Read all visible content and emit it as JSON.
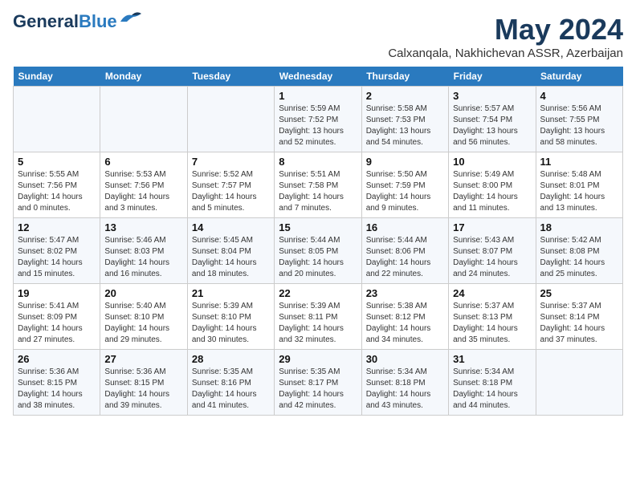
{
  "header": {
    "logo_line1": "General",
    "logo_line2": "Blue",
    "month": "May 2024",
    "location": "Calxanqala, Nakhichevan ASSR, Azerbaijan"
  },
  "days_of_week": [
    "Sunday",
    "Monday",
    "Tuesday",
    "Wednesday",
    "Thursday",
    "Friday",
    "Saturday"
  ],
  "weeks": [
    [
      {
        "day": "",
        "info": ""
      },
      {
        "day": "",
        "info": ""
      },
      {
        "day": "",
        "info": ""
      },
      {
        "day": "1",
        "info": "Sunrise: 5:59 AM\nSunset: 7:52 PM\nDaylight: 13 hours\nand 52 minutes."
      },
      {
        "day": "2",
        "info": "Sunrise: 5:58 AM\nSunset: 7:53 PM\nDaylight: 13 hours\nand 54 minutes."
      },
      {
        "day": "3",
        "info": "Sunrise: 5:57 AM\nSunset: 7:54 PM\nDaylight: 13 hours\nand 56 minutes."
      },
      {
        "day": "4",
        "info": "Sunrise: 5:56 AM\nSunset: 7:55 PM\nDaylight: 13 hours\nand 58 minutes."
      }
    ],
    [
      {
        "day": "5",
        "info": "Sunrise: 5:55 AM\nSunset: 7:56 PM\nDaylight: 14 hours\nand 0 minutes."
      },
      {
        "day": "6",
        "info": "Sunrise: 5:53 AM\nSunset: 7:56 PM\nDaylight: 14 hours\nand 3 minutes."
      },
      {
        "day": "7",
        "info": "Sunrise: 5:52 AM\nSunset: 7:57 PM\nDaylight: 14 hours\nand 5 minutes."
      },
      {
        "day": "8",
        "info": "Sunrise: 5:51 AM\nSunset: 7:58 PM\nDaylight: 14 hours\nand 7 minutes."
      },
      {
        "day": "9",
        "info": "Sunrise: 5:50 AM\nSunset: 7:59 PM\nDaylight: 14 hours\nand 9 minutes."
      },
      {
        "day": "10",
        "info": "Sunrise: 5:49 AM\nSunset: 8:00 PM\nDaylight: 14 hours\nand 11 minutes."
      },
      {
        "day": "11",
        "info": "Sunrise: 5:48 AM\nSunset: 8:01 PM\nDaylight: 14 hours\nand 13 minutes."
      }
    ],
    [
      {
        "day": "12",
        "info": "Sunrise: 5:47 AM\nSunset: 8:02 PM\nDaylight: 14 hours\nand 15 minutes."
      },
      {
        "day": "13",
        "info": "Sunrise: 5:46 AM\nSunset: 8:03 PM\nDaylight: 14 hours\nand 16 minutes."
      },
      {
        "day": "14",
        "info": "Sunrise: 5:45 AM\nSunset: 8:04 PM\nDaylight: 14 hours\nand 18 minutes."
      },
      {
        "day": "15",
        "info": "Sunrise: 5:44 AM\nSunset: 8:05 PM\nDaylight: 14 hours\nand 20 minutes."
      },
      {
        "day": "16",
        "info": "Sunrise: 5:44 AM\nSunset: 8:06 PM\nDaylight: 14 hours\nand 22 minutes."
      },
      {
        "day": "17",
        "info": "Sunrise: 5:43 AM\nSunset: 8:07 PM\nDaylight: 14 hours\nand 24 minutes."
      },
      {
        "day": "18",
        "info": "Sunrise: 5:42 AM\nSunset: 8:08 PM\nDaylight: 14 hours\nand 25 minutes."
      }
    ],
    [
      {
        "day": "19",
        "info": "Sunrise: 5:41 AM\nSunset: 8:09 PM\nDaylight: 14 hours\nand 27 minutes."
      },
      {
        "day": "20",
        "info": "Sunrise: 5:40 AM\nSunset: 8:10 PM\nDaylight: 14 hours\nand 29 minutes."
      },
      {
        "day": "21",
        "info": "Sunrise: 5:39 AM\nSunset: 8:10 PM\nDaylight: 14 hours\nand 30 minutes."
      },
      {
        "day": "22",
        "info": "Sunrise: 5:39 AM\nSunset: 8:11 PM\nDaylight: 14 hours\nand 32 minutes."
      },
      {
        "day": "23",
        "info": "Sunrise: 5:38 AM\nSunset: 8:12 PM\nDaylight: 14 hours\nand 34 minutes."
      },
      {
        "day": "24",
        "info": "Sunrise: 5:37 AM\nSunset: 8:13 PM\nDaylight: 14 hours\nand 35 minutes."
      },
      {
        "day": "25",
        "info": "Sunrise: 5:37 AM\nSunset: 8:14 PM\nDaylight: 14 hours\nand 37 minutes."
      }
    ],
    [
      {
        "day": "26",
        "info": "Sunrise: 5:36 AM\nSunset: 8:15 PM\nDaylight: 14 hours\nand 38 minutes."
      },
      {
        "day": "27",
        "info": "Sunrise: 5:36 AM\nSunset: 8:15 PM\nDaylight: 14 hours\nand 39 minutes."
      },
      {
        "day": "28",
        "info": "Sunrise: 5:35 AM\nSunset: 8:16 PM\nDaylight: 14 hours\nand 41 minutes."
      },
      {
        "day": "29",
        "info": "Sunrise: 5:35 AM\nSunset: 8:17 PM\nDaylight: 14 hours\nand 42 minutes."
      },
      {
        "day": "30",
        "info": "Sunrise: 5:34 AM\nSunset: 8:18 PM\nDaylight: 14 hours\nand 43 minutes."
      },
      {
        "day": "31",
        "info": "Sunrise: 5:34 AM\nSunset: 8:18 PM\nDaylight: 14 hours\nand 44 minutes."
      },
      {
        "day": "",
        "info": ""
      }
    ]
  ]
}
